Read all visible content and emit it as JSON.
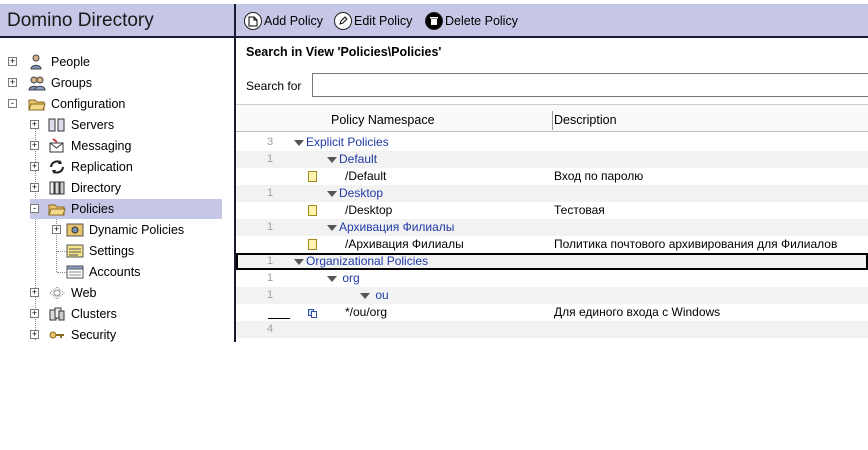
{
  "app": {
    "title": "Domino Directory"
  },
  "actions": [
    {
      "label": "Add Policy",
      "icon": "add-document-icon"
    },
    {
      "label": "Edit Policy",
      "icon": "edit-pencil-icon"
    },
    {
      "label": "Delete Policy",
      "icon": "delete-icon"
    }
  ],
  "navigator": {
    "items": [
      {
        "label": "People",
        "icon": "person-icon",
        "twisty": "+"
      },
      {
        "label": "Groups",
        "icon": "group-icon",
        "twisty": "+"
      },
      {
        "label": "Configuration",
        "icon": "folder-open-icon",
        "twisty": "-"
      },
      {
        "label": "Servers",
        "icon": "servers-icon",
        "twisty": "+"
      },
      {
        "label": "Messaging",
        "icon": "messaging-icon",
        "twisty": "+"
      },
      {
        "label": "Replication",
        "icon": "replication-icon",
        "twisty": "+"
      },
      {
        "label": "Directory",
        "icon": "directory-icon",
        "twisty": "+"
      },
      {
        "label": "Policies",
        "icon": "policies-icon",
        "twisty": "-",
        "selected": true
      },
      {
        "label": "Dynamic Policies",
        "icon": "dynamic-policies-icon",
        "twisty": "+"
      },
      {
        "label": "Settings",
        "icon": "settings-icon",
        "twisty": ""
      },
      {
        "label": "Accounts",
        "icon": "accounts-icon",
        "twisty": ""
      },
      {
        "label": "Web",
        "icon": "web-icon",
        "twisty": "+"
      },
      {
        "label": "Clusters",
        "icon": "clusters-icon",
        "twisty": "+"
      },
      {
        "label": "Security",
        "icon": "key-icon",
        "twisty": "+"
      }
    ]
  },
  "search": {
    "title": "Search in View 'Policies\\Policies'",
    "label": "Search for",
    "value": ""
  },
  "view": {
    "columns": [
      "Policy Namespace",
      "Description"
    ],
    "rows": [
      {
        "count": "3",
        "category": "Explicit Policies"
      },
      {
        "count": "1",
        "category": "Default"
      },
      {
        "namespace": "/Default",
        "description": "Вход по паролю"
      },
      {
        "count": "1",
        "category": "Desktop"
      },
      {
        "namespace": "/Desktop",
        "description": "Тестовая"
      },
      {
        "count": "1",
        "category": "Архивация Филиалы"
      },
      {
        "namespace": "/Архивация Филиалы",
        "description": "Политика почтового архивирования для Филиалов"
      },
      {
        "count": "1",
        "category": "Organizational Policies"
      },
      {
        "count": "1",
        "category": "org"
      },
      {
        "count": "1",
        "category": "ou"
      },
      {
        "namespace": "*/ou/org",
        "description": "Для единого входа с Windows"
      },
      {
        "count": "4"
      }
    ]
  }
}
